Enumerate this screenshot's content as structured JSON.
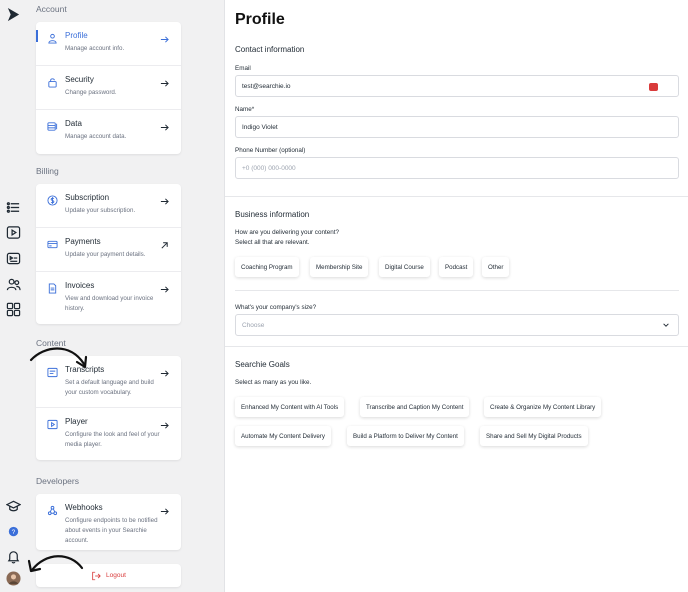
{
  "sidebar": {
    "sections": {
      "account": "Account",
      "billing": "Billing",
      "content": "Content",
      "developers": "Developers"
    },
    "items": {
      "profile": {
        "title": "Profile",
        "desc": "Manage account info."
      },
      "security": {
        "title": "Security",
        "desc": "Change password."
      },
      "data": {
        "title": "Data",
        "desc": "Manage account data."
      },
      "subscription": {
        "title": "Subscription",
        "desc": "Update your subscription."
      },
      "payments": {
        "title": "Payments",
        "desc": "Update your payment details."
      },
      "invoices": {
        "title": "Invoices",
        "desc": "View and download your invoice history."
      },
      "transcripts": {
        "title": "Transcripts",
        "desc": "Set a default language and build your custom vocabulary."
      },
      "player": {
        "title": "Player",
        "desc": "Configure the look and feel of your media player."
      },
      "webhooks": {
        "title": "Webhooks",
        "desc": "Configure endpoints to be notified about events in your Searchie account."
      }
    },
    "logout_label": "Logout"
  },
  "main": {
    "title": "Profile",
    "contact": {
      "heading": "Contact information",
      "email_label": "Email",
      "email_value": "test@searchie.io",
      "name_label": "Name*",
      "name_value": "Indigo Violet",
      "phone_label": "Phone Number (optional)",
      "phone_placeholder": "+0 (000) 000-0000"
    },
    "business": {
      "heading": "Business information",
      "question": "How are you delivering your content?",
      "hint": "Select all that are relevant.",
      "chips": [
        "Coaching Program",
        "Membership Site",
        "Digital Course",
        "Podcast",
        "Other"
      ],
      "size_label": "What's your company's size?",
      "size_value": "Choose"
    },
    "goals": {
      "heading": "Searchie Goals",
      "hint": "Select as many as you like.",
      "chips": [
        "Enhanced My Content with AI Tools",
        "Transcribe and Caption My Content",
        "Create & Organize My Content Library",
        "Automate My Content Delivery",
        "Build a Platform to Deliver My Content",
        "Share and Sell My Digital Products"
      ]
    }
  },
  "colors": {
    "accent": "#3b6fd9",
    "danger": "#d93b3b",
    "panel_bg": "#f1f1f2"
  }
}
